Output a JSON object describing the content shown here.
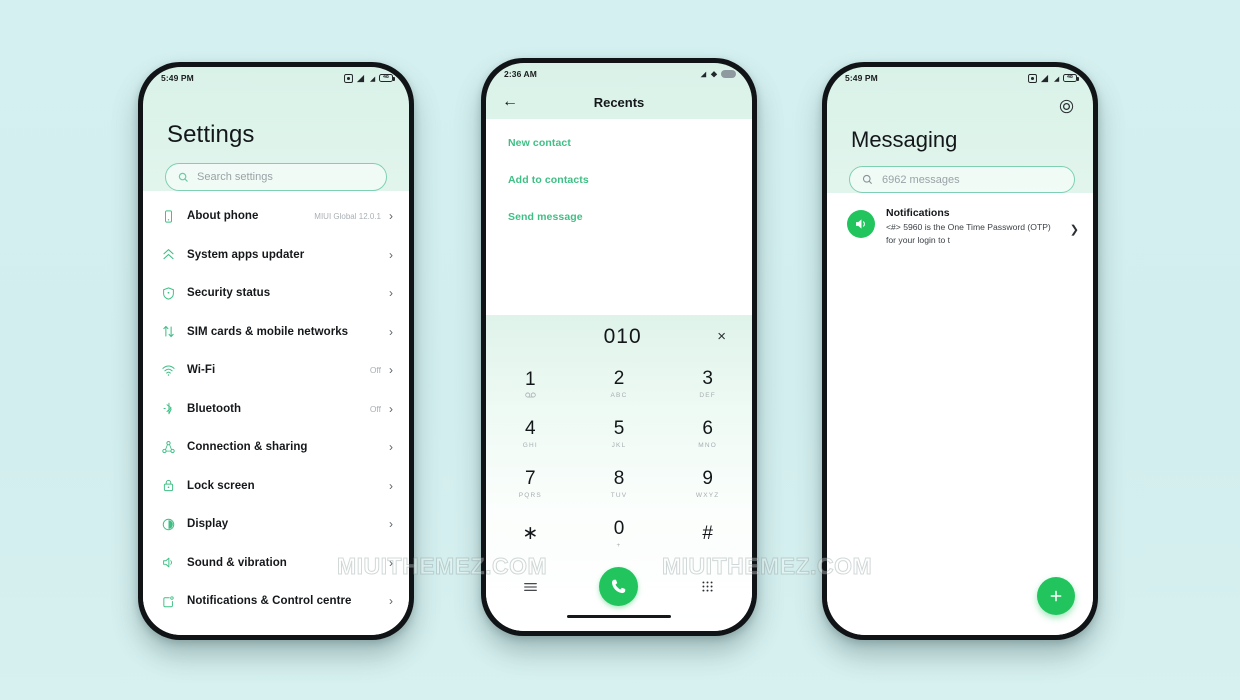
{
  "theme": {
    "background": "#d4efef",
    "accent_green": "#22c45e",
    "accent_teal": "#3fbf85",
    "outline_green": "#7ed0b2",
    "text_primary": "#15181b",
    "text_muted": "#a9b0b4"
  },
  "watermarks": [
    {
      "text": "MIUITHEMEZ.COM"
    },
    {
      "text": "MIUITHEMEZ.COM"
    }
  ],
  "phones": {
    "settings": {
      "status_bar": {
        "time": "5:49 PM",
        "icons": [
          "alarm-icon",
          "signal-icon",
          "signal-icon"
        ],
        "battery_label": "48"
      },
      "title": "Settings",
      "search": {
        "placeholder": "Search settings",
        "icon": "search-icon"
      },
      "items": [
        {
          "icon": "phone-outline-icon",
          "label": "About phone",
          "value": "MIUI Global 12.0.1",
          "chevron": "›"
        },
        {
          "icon": "chevrons-up-icon",
          "label": "System apps updater",
          "value": "",
          "chevron": "›"
        },
        {
          "icon": "shield-icon",
          "label": "Security status",
          "value": "",
          "chevron": "›"
        },
        {
          "icon": "sim-transfer-icon",
          "label": "SIM cards & mobile networks",
          "value": "",
          "chevron": "›"
        },
        {
          "icon": "wifi-icon",
          "label": "Wi-Fi",
          "value": "Off",
          "chevron": "›"
        },
        {
          "icon": "bluetooth-icon",
          "label": "Bluetooth",
          "value": "Off",
          "chevron": "›"
        },
        {
          "icon": "connection-sharing-icon",
          "label": "Connection & sharing",
          "value": "",
          "chevron": "›"
        },
        {
          "icon": "lock-icon",
          "label": "Lock screen",
          "value": "",
          "chevron": "›"
        },
        {
          "icon": "display-icon",
          "label": "Display",
          "value": "",
          "chevron": "›"
        },
        {
          "icon": "speaker-icon",
          "label": "Sound & vibration",
          "value": "",
          "chevron": "›"
        },
        {
          "icon": "notification-square-icon",
          "label": "Notifications & Control centre",
          "value": "",
          "chevron": "›"
        }
      ]
    },
    "dialer": {
      "status_bar": {
        "time": "2:36 AM",
        "icons": [
          "signal-icon",
          "wifi-icon",
          "battery-pill-icon"
        ]
      },
      "app_bar": {
        "back_icon": "arrow-left-icon",
        "title": "Recents"
      },
      "actions": [
        {
          "label": "New contact"
        },
        {
          "label": "Add to contacts"
        },
        {
          "label": "Send message"
        }
      ],
      "entry": {
        "number": "010",
        "clear_icon": "close-icon"
      },
      "keys": [
        {
          "digit": "1",
          "sub": "⍦⍦"
        },
        {
          "digit": "2",
          "sub": "ABC"
        },
        {
          "digit": "3",
          "sub": "DEF"
        },
        {
          "digit": "4",
          "sub": "GHI"
        },
        {
          "digit": "5",
          "sub": "JKL"
        },
        {
          "digit": "6",
          "sub": "MNO"
        },
        {
          "digit": "7",
          "sub": "PQRS"
        },
        {
          "digit": "8",
          "sub": "TUV"
        },
        {
          "digit": "9",
          "sub": "WXYZ"
        },
        {
          "digit": "∗",
          "sub": ""
        },
        {
          "digit": "0",
          "sub": "+"
        },
        {
          "digit": "#",
          "sub": ""
        }
      ],
      "bottom_bar": {
        "menu_icon": "menu-icon",
        "call_icon": "call-icon",
        "keypad_icon": "keypad-icon"
      }
    },
    "messaging": {
      "status_bar": {
        "time": "5:49 PM",
        "icons": [
          "alarm-icon",
          "signal-icon",
          "signal-icon"
        ],
        "battery_label": "48"
      },
      "header_icon": "target-icon",
      "title": "Messaging",
      "search": {
        "placeholder": "6962 messages",
        "icon": "search-icon"
      },
      "conversations": [
        {
          "avatar_icon": "speaker-icon",
          "name": "Notifications",
          "preview": "<#> 5960 is the One Time Password (OTP) for your login to t",
          "chevron": "❯"
        }
      ],
      "fab": {
        "icon": "plus-icon"
      }
    }
  }
}
